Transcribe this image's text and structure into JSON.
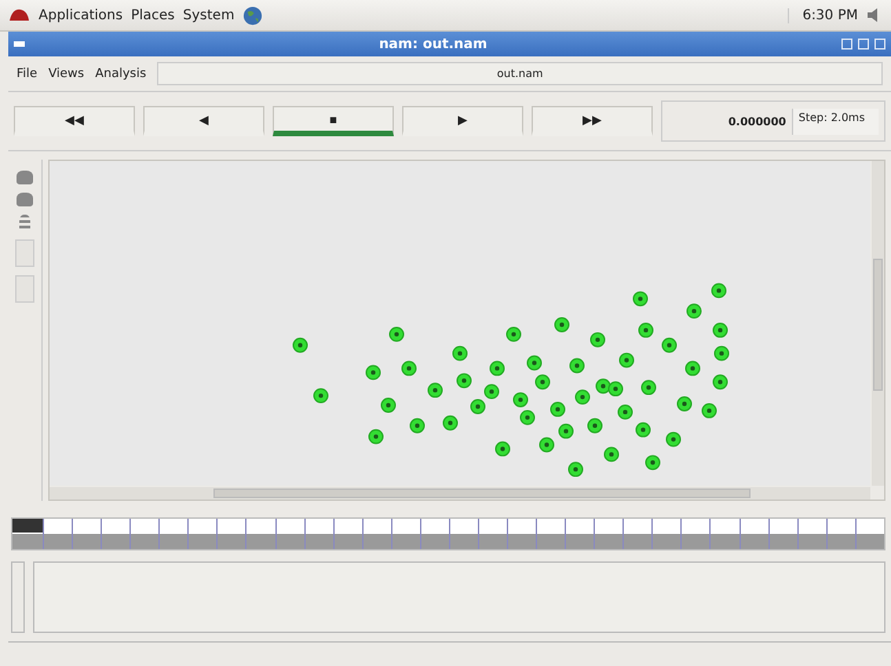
{
  "panel": {
    "menus": [
      "Applications",
      "Places",
      "System"
    ],
    "clock": "6:30 PM"
  },
  "window": {
    "title": "nam: out.nam"
  },
  "menu": [
    "File",
    "Views",
    "Analysis"
  ],
  "file_label": "out.nam",
  "controls": [
    {
      "glyph": "◀◀",
      "selected": false
    },
    {
      "glyph": "◀",
      "selected": false
    },
    {
      "glyph": "■",
      "selected": true
    },
    {
      "glyph": "▶",
      "selected": false
    },
    {
      "glyph": "▶▶",
      "selected": false
    }
  ],
  "time": "0.000000",
  "step": "Step: 2.0ms"
}
